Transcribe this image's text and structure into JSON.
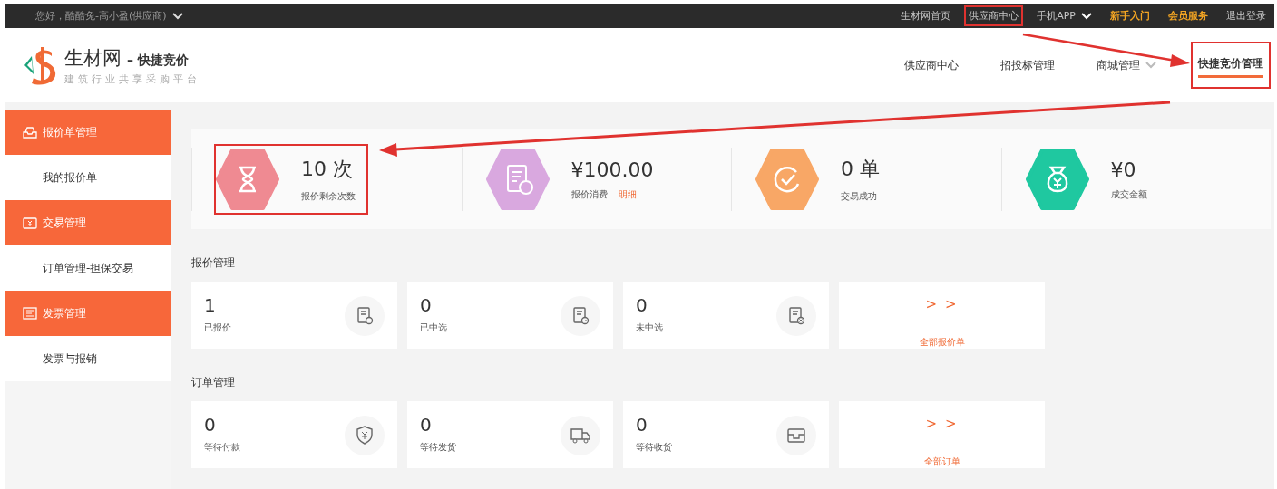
{
  "top_bar": {
    "greeting": "您好，酷酷兔-高小盈(供应商)",
    "links": [
      {
        "label": "生材网首页",
        "kind": "plain",
        "highlighted": false
      },
      {
        "label": "供应商中心",
        "kind": "plain",
        "highlighted": true
      },
      {
        "label": "手机APP",
        "kind": "dropdown",
        "highlighted": false
      },
      {
        "label": "新手入门",
        "kind": "accent",
        "highlighted": false
      },
      {
        "label": "会员服务",
        "kind": "accent",
        "highlighted": false
      },
      {
        "label": "退出登录",
        "kind": "plain",
        "highlighted": false
      }
    ]
  },
  "logo": {
    "name": "生材网",
    "suffix": "– 快捷竞价",
    "tagline": "建筑行业共享采购平台"
  },
  "main_nav": [
    {
      "label": "供应商中心",
      "selected": false,
      "dropdown": false,
      "highlighted": false
    },
    {
      "label": "招投标管理",
      "selected": false,
      "dropdown": false,
      "highlighted": false
    },
    {
      "label": "商城管理",
      "selected": false,
      "dropdown": true,
      "highlighted": false
    },
    {
      "label": "快捷竞价管理",
      "selected": true,
      "dropdown": false,
      "highlighted": true
    }
  ],
  "sidebar": [
    {
      "label": "报价单管理",
      "children": [
        {
          "label": "我的报价单"
        }
      ]
    },
    {
      "label": "交易管理",
      "children": [
        {
          "label": "订单管理-担保交易"
        }
      ]
    },
    {
      "label": "发票管理",
      "children": [
        {
          "label": "发票与报销"
        }
      ]
    }
  ],
  "stats": [
    {
      "value": "10 次",
      "label": "报价剩余次数",
      "color": "#ef8a92",
      "highlighted": true
    },
    {
      "value": "¥100.00",
      "label": "报价消费",
      "link": "明细",
      "color": "#d9a8df",
      "highlighted": false
    },
    {
      "value": "0 单",
      "label": "交易成功",
      "color": "#f8a766",
      "highlighted": false
    },
    {
      "value": "¥0",
      "label": "成交金额",
      "color": "#1fc8a0",
      "highlighted": false
    }
  ],
  "sections": [
    {
      "title": "报价管理",
      "cards": [
        {
          "kind": "count",
          "value": "1",
          "label": "已报价"
        },
        {
          "kind": "count",
          "value": "0",
          "label": "已中选"
        },
        {
          "kind": "count",
          "value": "0",
          "label": "未中选"
        },
        {
          "kind": "link",
          "arrows": "> >",
          "label": "全部报价单"
        }
      ]
    },
    {
      "title": "订单管理",
      "cards": [
        {
          "kind": "count",
          "value": "0",
          "label": "等待付款"
        },
        {
          "kind": "count",
          "value": "0",
          "label": "等待发货"
        },
        {
          "kind": "count",
          "value": "0",
          "label": "等待收货"
        },
        {
          "kind": "link",
          "arrows": "> >",
          "label": "全部订单"
        }
      ]
    }
  ]
}
